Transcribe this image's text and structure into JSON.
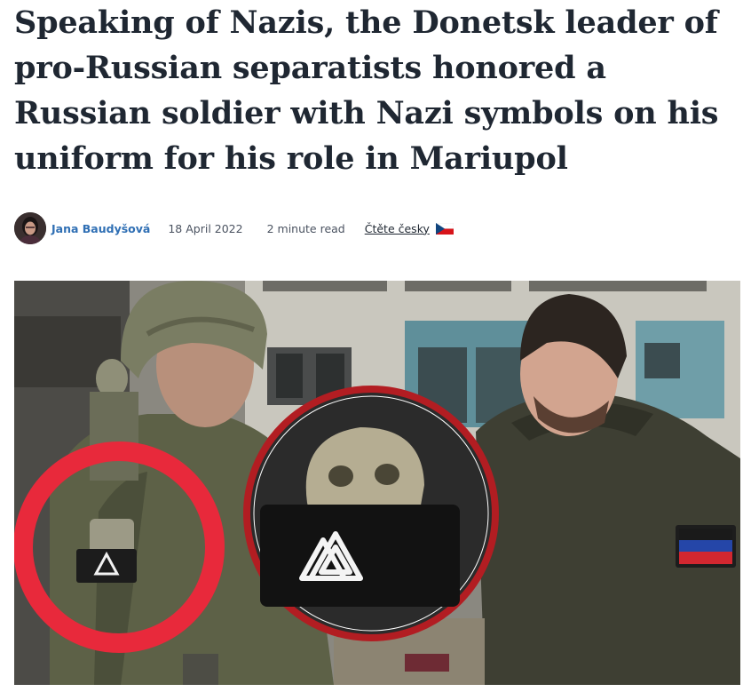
{
  "article": {
    "title": "Speaking of Nazis, the Donetsk leader of pro-Russian separatists honored a Russian soldier with Nazi symbols on his uniform for his role in Mariupol",
    "author": "Jana Baudyšová",
    "date": "18 April 2022",
    "read_time": "2 minute read",
    "language_link": "Čtěte česky"
  },
  "icons": {
    "author_avatar": "avatar",
    "language_flag": "czech-flag-icon"
  },
  "colors": {
    "headline": "#1f2732",
    "author_link": "#2f6fb4",
    "circle_left": "#e8293b",
    "circle_right": "#b21d22"
  }
}
